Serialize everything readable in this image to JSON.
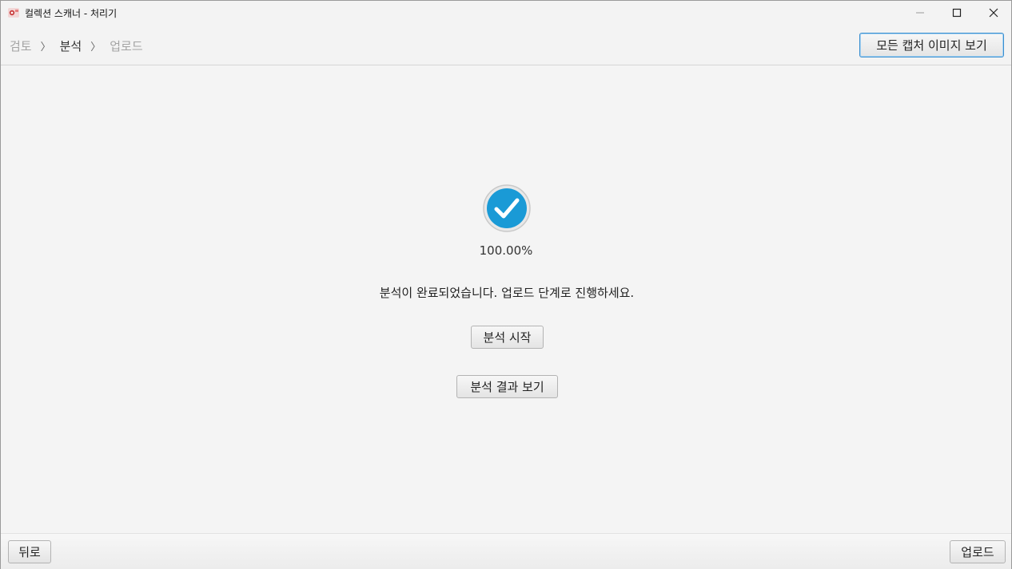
{
  "window": {
    "title": "컬렉션 스캐너 - 처리기",
    "app_icon": "app-icon",
    "controls": [
      "minimize-icon",
      "maximize-icon",
      "close-icon"
    ]
  },
  "header": {
    "breadcrumb": [
      {
        "label": "검토",
        "active": false
      },
      {
        "label": "분석",
        "active": true
      },
      {
        "label": "업로드",
        "active": false
      }
    ],
    "separator": "〉",
    "view_all_captures_label": "모든 캡처 이미지 보기"
  },
  "main": {
    "status_icon": "check-circle-icon",
    "progress_percent": 100,
    "progress_text": "100.00%",
    "message": "분석이 완료되었습니다. 업로드 단계로 진행하세요.",
    "start_analysis_label": "분석 시작",
    "view_results_label": "분석 결과 보기"
  },
  "footer": {
    "back_label": "뒤로",
    "upload_label": "업로드"
  },
  "colors": {
    "accent": "#1a9ad6",
    "focus_border": "#3a8fd0",
    "breadcrumb_inactive": "#a3a3a3"
  }
}
